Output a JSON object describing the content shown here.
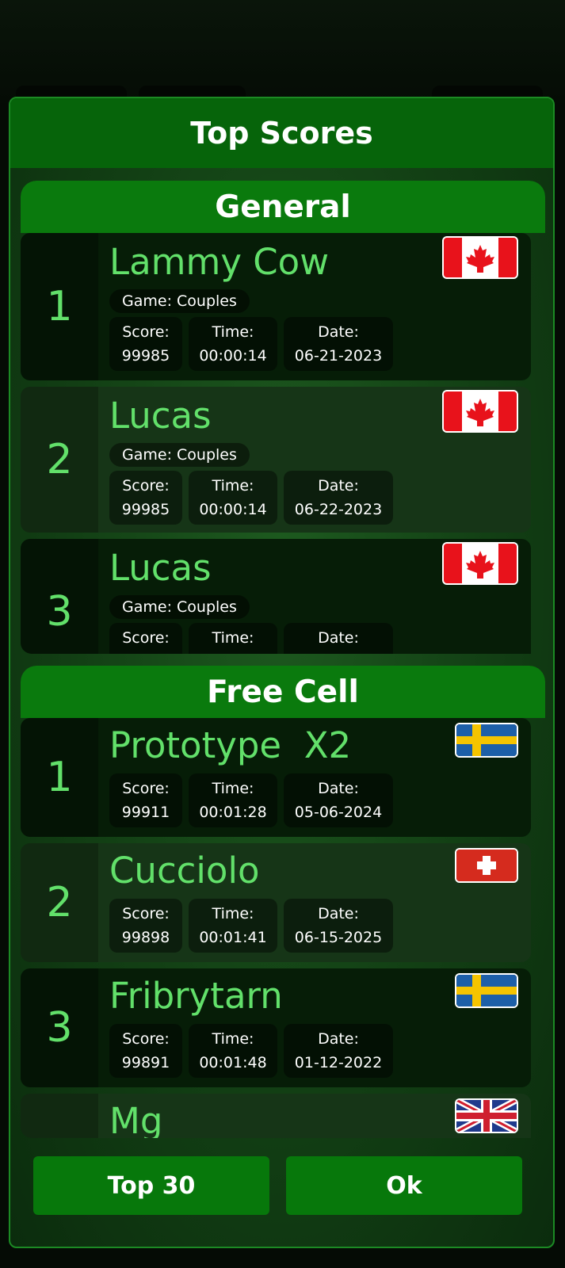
{
  "dialog": {
    "title": "Top Scores"
  },
  "labels": {
    "score": "Score:",
    "time": "Time:",
    "date": "Date:"
  },
  "sections": [
    {
      "title": "General",
      "entries": [
        {
          "rank": "1",
          "name": "Lammy Cow",
          "game": "Game: Couples",
          "score": "99985",
          "time": "00:00:14",
          "date": "06-21-2023",
          "flag": "canada-flag-icon"
        },
        {
          "rank": "2",
          "name": "Lucas",
          "game": "Game: Couples",
          "score": "99985",
          "time": "00:00:14",
          "date": "06-22-2023",
          "flag": "canada-flag-icon"
        },
        {
          "rank": "3",
          "name": "Lucas",
          "game": "Game: Couples",
          "flag": "canada-flag-icon"
        }
      ]
    },
    {
      "title": "Free Cell",
      "entries": [
        {
          "rank": "1",
          "name": "Prototype  X2",
          "score": "99911",
          "time": "00:01:28",
          "date": "05-06-2024",
          "flag": "sweden-flag-icon"
        },
        {
          "rank": "2",
          "name": "Cucciolo",
          "score": "99898",
          "time": "00:01:41",
          "date": "06-15-2025",
          "flag": "switzerland-flag-icon"
        },
        {
          "rank": "3",
          "name": "Fribrytarn",
          "score": "99891",
          "time": "00:01:48",
          "date": "01-12-2022",
          "flag": "sweden-flag-icon"
        },
        {
          "rank": "",
          "name": "Mg",
          "flag": "uk-flag-icon"
        }
      ]
    }
  ],
  "buttons": {
    "top30": "Top 30",
    "ok": "Ok"
  },
  "colors": {
    "accent_green": "#62e06a",
    "header_green": "#0a7a0d",
    "button_green": "#07780b"
  }
}
